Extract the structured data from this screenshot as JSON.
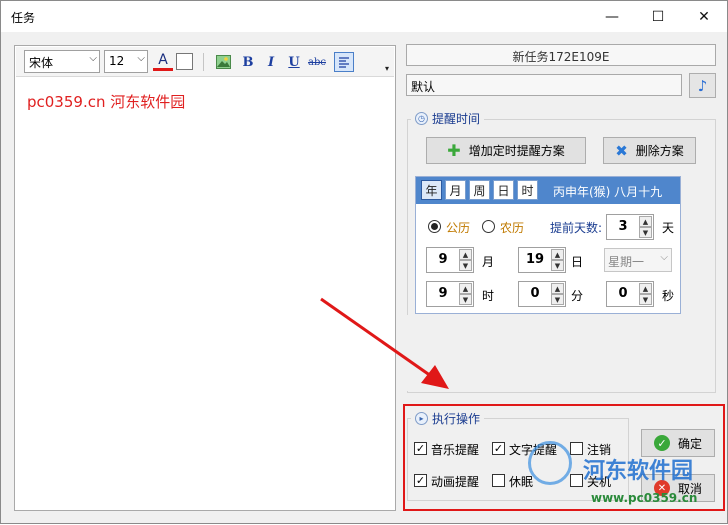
{
  "window": {
    "title": "任务",
    "min": "—",
    "max": "☐",
    "close": "✕"
  },
  "toolbar": {
    "font": "宋体",
    "size": "12",
    "font_color_glyph": "A",
    "bold": "B",
    "italic": "I",
    "underline": "U",
    "strike": "abc"
  },
  "editor": {
    "content": "pc0359.cn 河东软件园"
  },
  "task": {
    "name": "新任务172E109E",
    "sound": "默认"
  },
  "reminder": {
    "title": "提醒时间",
    "add_label": "增加定时提醒方案",
    "delete_label": "删除方案",
    "tabs": [
      "年",
      "月",
      "周",
      "日",
      "时"
    ],
    "lunar": "丙申年(猴) 八月十九",
    "solar_label": "公历",
    "lunar_label": "农历",
    "advance_label": "提前天数:",
    "advance_value": "3",
    "day_unit": "天",
    "month_value": "9",
    "month_unit": "月",
    "day_value": "19",
    "day_of_month_unit": "日",
    "weekday": "星期一",
    "hour_value": "9",
    "hour_unit": "时",
    "minute_value": "0",
    "minute_unit": "分",
    "second_value": "0",
    "second_unit": "秒"
  },
  "actions": {
    "title": "执行操作",
    "music": "音乐提醒",
    "text": "文字提醒",
    "logout": "注销",
    "animation": "动画提醒",
    "sleep": "休眠",
    "shutdown": "关机",
    "ok": "确定",
    "cancel": "取消"
  },
  "watermark": {
    "name": "河东软件园",
    "url": "www.pc0359.cn"
  },
  "colors": {
    "accent": "#4f86cc",
    "annotation": "#e01818",
    "content_text": "#e02020"
  }
}
